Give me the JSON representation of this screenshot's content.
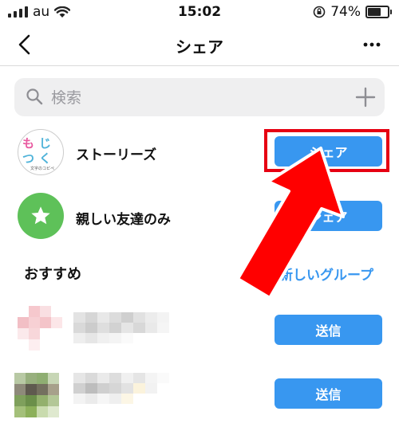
{
  "status_bar": {
    "carrier": "au",
    "time": "15:02",
    "battery": "74%",
    "battery_level": 0.74
  },
  "nav": {
    "title": "シェア"
  },
  "search": {
    "placeholder": "検索"
  },
  "stories": {
    "label": "ストーリーズ",
    "button": "シェア"
  },
  "close_friends": {
    "label": "親しい友達のみ",
    "button": "シェア"
  },
  "avatar_logo": {
    "text": "もじつく",
    "subtitle": "文字のコピペ"
  },
  "suggested": {
    "title": "おすすめ",
    "new_group": "新しいグループ",
    "send_label": "送信"
  },
  "colors": {
    "accent": "#3897f0",
    "highlight": "#e60012",
    "close_friends": "#5ec159"
  },
  "icons": [
    "back-chevron-icon",
    "more-icon",
    "search-icon",
    "plus-icon",
    "star-icon",
    "wifi-icon",
    "battery-icon",
    "arrow-icon"
  ]
}
